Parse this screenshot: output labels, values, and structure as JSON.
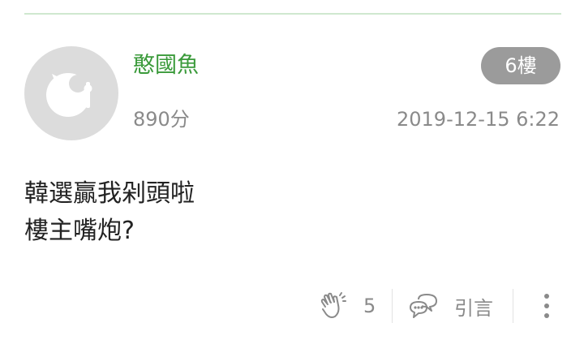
{
  "post": {
    "username": "憨國魚",
    "score": "890分",
    "floor": "6樓",
    "timestamp": "2019-12-15 6:22",
    "content_lines": [
      "韓選贏我剁頭啦",
      "樓主嘴炮?"
    ]
  },
  "actions": {
    "like_icon": "clap-hands-icon",
    "like_count": "5",
    "quote_icon": "speech-bubbles-icon",
    "quote_label": "引言",
    "more_icon": "vertical-dots-icon"
  },
  "colors": {
    "username": "#3a9a3a",
    "muted_text": "#8a8a8a",
    "badge_bg": "#9b9b9b",
    "avatar_bg": "#dcdcdc",
    "divider": "#cfe8cf"
  }
}
